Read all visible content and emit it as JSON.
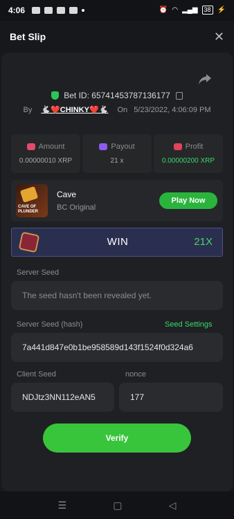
{
  "status_bar": {
    "time": "4:06",
    "battery": "38"
  },
  "header": {
    "title": "Bet Slip",
    "close_icon": "close-icon"
  },
  "bet": {
    "id_label": "Bet ID:",
    "id": "65741453787136177",
    "by_label": "By",
    "user": "🐇❤️CHINKY❤️🐇",
    "on_label": "On",
    "datetime": "5/23/2022, 4:06:09 PM"
  },
  "stats": [
    {
      "label": "Amount",
      "value": "0.00000010 XRP",
      "icon_color": "#e24b6b"
    },
    {
      "label": "Payout",
      "value": "21 x",
      "icon_color": "#8a5cf0"
    },
    {
      "label": "Profit",
      "value": "0.00000200 XRP",
      "icon_color": "#e0435a"
    }
  ],
  "game": {
    "name": "Cave",
    "subtitle": "BC Original",
    "thumb_text": "CAVE OF PLUNDER",
    "play_label": "Play Now"
  },
  "result": {
    "label": "WIN",
    "multiplier": "21X"
  },
  "server_seed": {
    "label": "Server Seed",
    "placeholder": "The seed hasn't been revealed yet."
  },
  "server_seed_hash": {
    "label": "Server Seed (hash)",
    "settings_link": "Seed Settings",
    "value": "7a441d847e0b1be958589d143f1524f0d324a6"
  },
  "client_seed": {
    "label": "Client Seed",
    "value": "NDJtz3NN112eAN5"
  },
  "nonce": {
    "label": "nonce",
    "value": "177"
  },
  "verify_label": "Verify",
  "colors": {
    "accent_green": "#38c53c",
    "background": "#17181b",
    "panel": "#1f2023"
  }
}
